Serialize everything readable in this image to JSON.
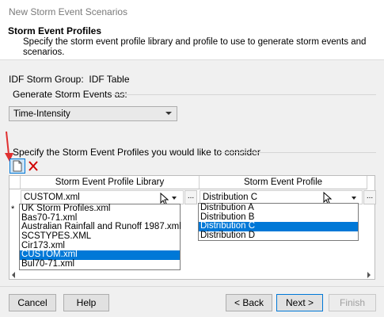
{
  "window": {
    "title": "New Storm Event Scenarios"
  },
  "header": {
    "title": "Storm Event Profiles",
    "description": "Specify the storm event profile library and profile to use to generate storm events and scenarios."
  },
  "idf": {
    "label": "IDF Storm Group:",
    "value": "IDF Table"
  },
  "generate": {
    "label": "Generate Storm Events as:",
    "selected": "Time-Intensity"
  },
  "profiles_section": {
    "label": "Specify the Storm Event Profiles you would like to consider"
  },
  "toolbar": {
    "new_icon": "new-document-icon",
    "delete_icon": "delete-x-icon"
  },
  "grid": {
    "columns": [
      "Storm Event Profile Library",
      "Storm Event Profile"
    ],
    "row": {
      "library": "CUSTOM.xml",
      "profile": "Distribution C",
      "dots": "...",
      "marker": "*"
    }
  },
  "library_dropdown": {
    "options": [
      "UK Storm Profiles.xml",
      "Bas70-71.xml",
      "Australian Rainfall and Runoff 1987.xml",
      "SCSTYPES.XML",
      "Cir173.xml",
      "CUSTOM.xml",
      "Bul70-71.xml"
    ],
    "selected": "CUSTOM.xml"
  },
  "profile_dropdown": {
    "options": [
      "Distribution A",
      "Distribution B",
      "Distribution C",
      "Distribution D"
    ],
    "selected": "Distribution C"
  },
  "buttons": {
    "cancel": "Cancel",
    "help": "Help",
    "back": "< Back",
    "next": "Next >",
    "finish": "Finish"
  },
  "colors": {
    "accent": "#0078d7",
    "annotation_arrow": "#e03030"
  }
}
